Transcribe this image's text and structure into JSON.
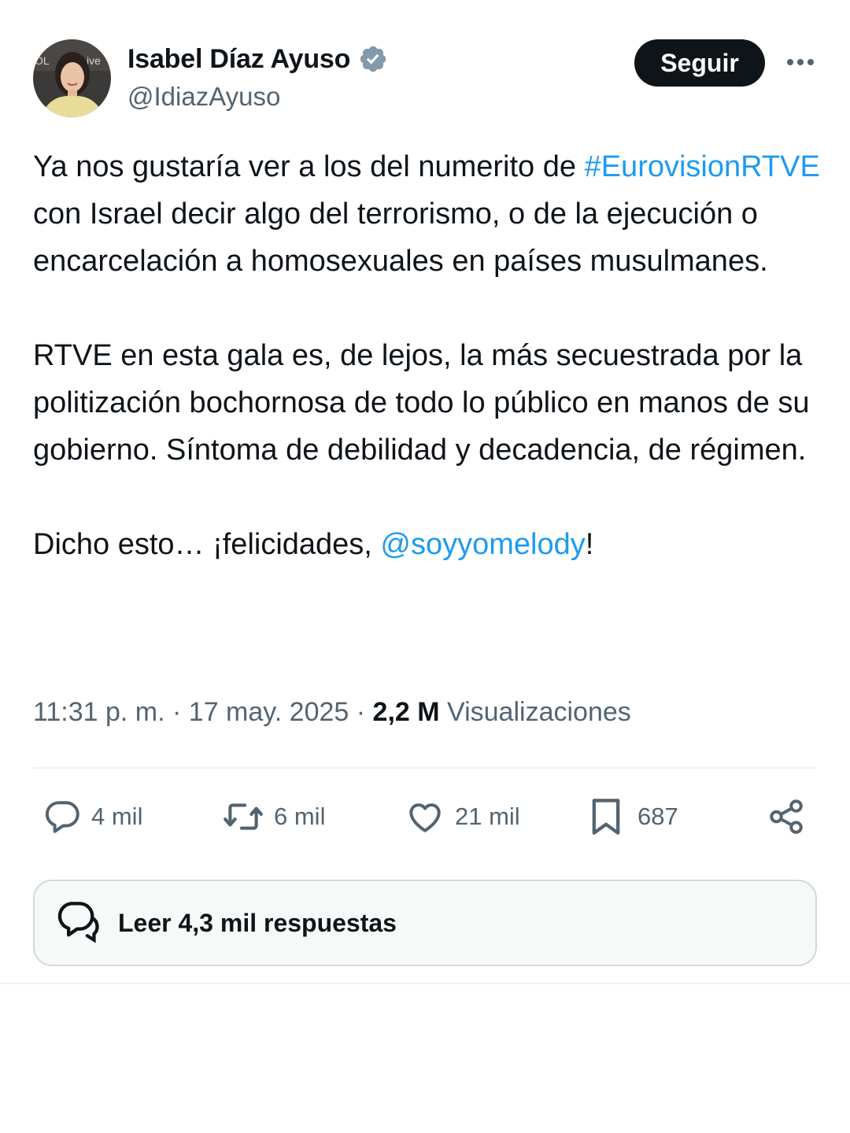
{
  "author": {
    "display_name": "Isabel Díaz Ayuso",
    "handle": "@IdiazAyuso",
    "verified": true,
    "avatar_icon": "profile-photo"
  },
  "header": {
    "follow_label": "Seguir",
    "more_icon": "ellipsis-icon"
  },
  "tweet": {
    "p1_a": "Ya nos gustaría ver a los del numerito de ",
    "p1_hashtag": "#EurovisionRTVE",
    "p1_b": " con Israel decir algo del terrorismo, o de la ejecución o encarcelación a homosexuales en países musulmanes.",
    "p2": "RTVE en esta gala es, de lejos, la más secuestrada por la politización bochornosa de todo lo público en manos de su gobierno. Síntoma de debilidad y decadencia, de régimen.",
    "p3_a": "Dicho esto… ¡felicidades, ",
    "p3_mention": "@soyyomelody",
    "p3_b": "!"
  },
  "meta": {
    "time": "11:31 p. m.",
    "sep1": " · ",
    "date": "17 may. 2025",
    "sep2": " · ",
    "views_count": "2,2 M",
    "views_label": " Visualizaciones"
  },
  "actions": {
    "replies": "4 mil",
    "reposts": "6 mil",
    "likes": "21 mil",
    "bookmarks": "687"
  },
  "read_replies_label": "Leer 4,3 mil respuestas",
  "colors": {
    "link": "#1d9bf0",
    "text": "#0f1419",
    "secondary": "#536471",
    "verified_badge": "#829aab",
    "border": "#cfd9de"
  }
}
